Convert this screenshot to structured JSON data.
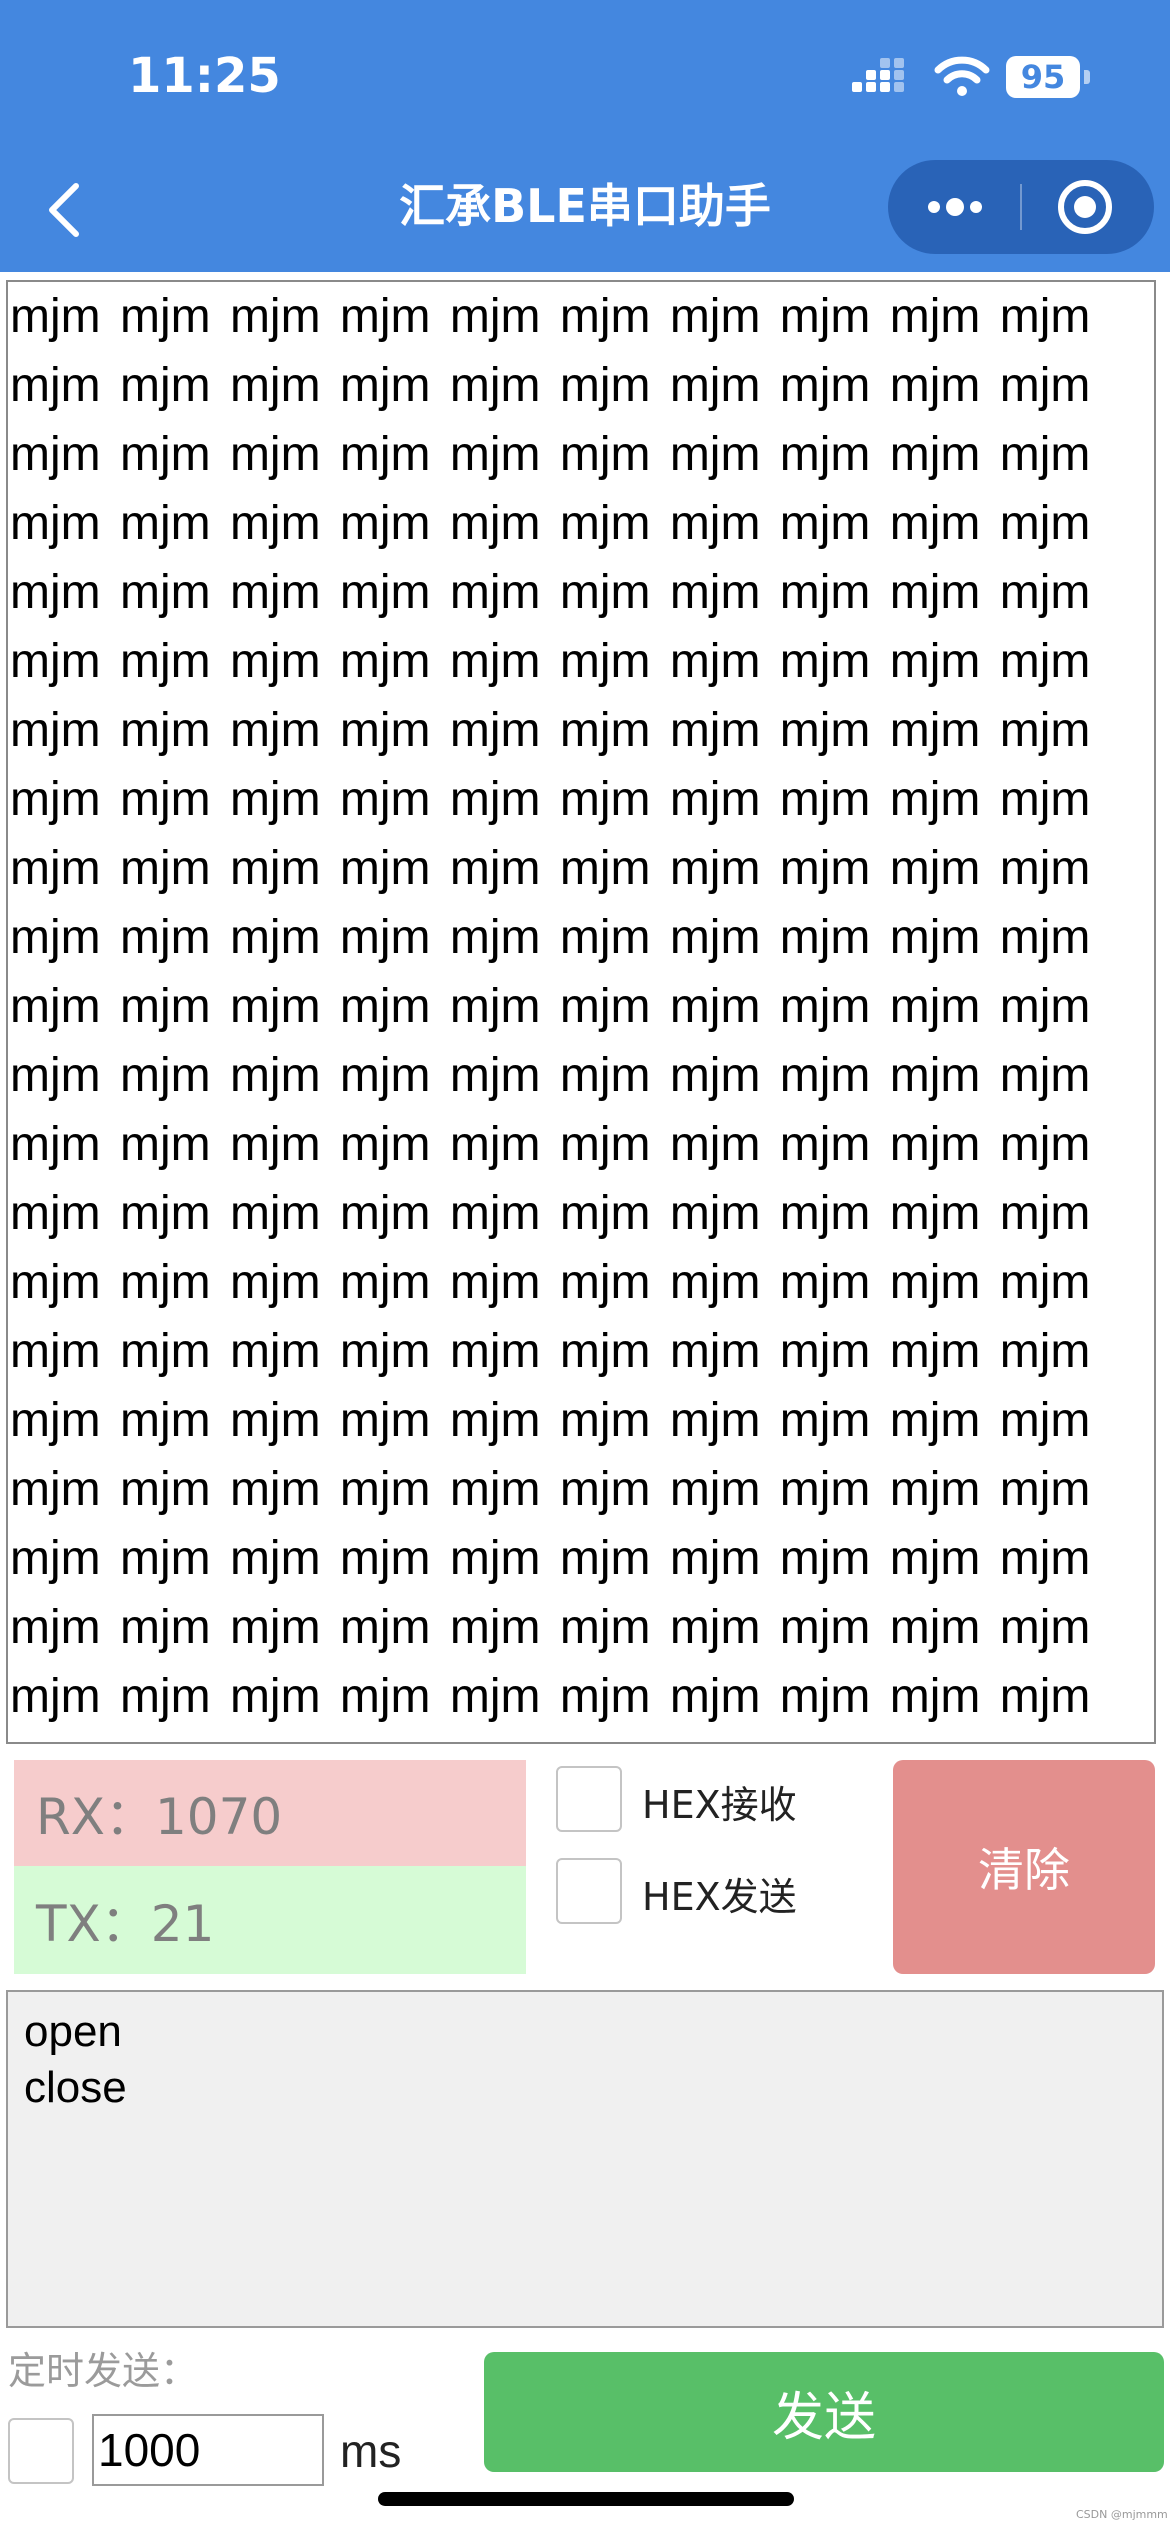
{
  "status_bar": {
    "time": "11:25",
    "battery": "95",
    "icons": [
      "signal-icon",
      "wifi-icon",
      "battery-icon"
    ]
  },
  "nav": {
    "title": "汇承BLE串口助手",
    "back_icon": "chevron-left-icon",
    "more_icon": "more-dots-icon",
    "close_icon": "target-circle-icon"
  },
  "receive": {
    "token": "mjm",
    "rows": 21,
    "cols": 10
  },
  "counters": {
    "rx": "RX：1070",
    "tx": "TX：21"
  },
  "options": {
    "hex_receive": "HEX接收",
    "hex_send": "HEX发送"
  },
  "buttons": {
    "clear": "清除",
    "send": "发送"
  },
  "send_input": {
    "value": "open\nclose"
  },
  "timer": {
    "label": "定时发送：",
    "interval": "1000",
    "unit": "ms"
  },
  "watermark": "CSDN @mjmmm",
  "colors": {
    "nav_bg": "#4487df",
    "rx_bg": "#f6cccc",
    "tx_bg": "#d6fbd6",
    "clear_btn": "#e38f8d",
    "send_btn": "#58bf68"
  }
}
